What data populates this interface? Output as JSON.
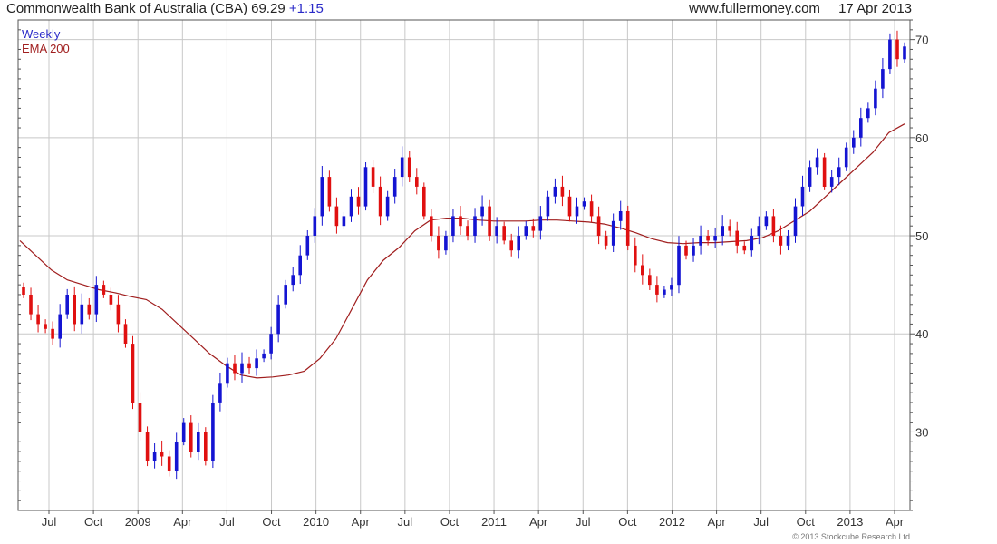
{
  "header": {
    "title": "Commonwealth Bank of Australia (CBA)",
    "price": "69.29",
    "change": "+1.15",
    "site": "www.fullermoney.com",
    "date": "17 Apr 2013"
  },
  "legend": {
    "line1": "Weekly",
    "line2": "EMA 200"
  },
  "copyright": "© 2013 Stockcube Research Ltd",
  "colors": {
    "up": "#1414d2",
    "down": "#e01010",
    "ema": "#a01e1e",
    "grid": "#c8c8c8",
    "axis": "#555555"
  },
  "chart_data": {
    "type": "candlestick",
    "x_ticks": [
      "Jul",
      "Oct",
      "2009",
      "Apr",
      "Jul",
      "Oct",
      "2010",
      "Apr",
      "Jul",
      "Oct",
      "2011",
      "Apr",
      "Jul",
      "Oct",
      "2012",
      "Apr",
      "Jul",
      "Oct",
      "2013",
      "Apr"
    ],
    "y_ticks": [
      30,
      40,
      50,
      60,
      70
    ],
    "ylim": [
      22,
      72
    ],
    "close": [
      44,
      42,
      41,
      40.5,
      39.5,
      42,
      44,
      41,
      43,
      42,
      45,
      44,
      43,
      41,
      39,
      33,
      30,
      27,
      28,
      27.5,
      26,
      29,
      31,
      28,
      30,
      27,
      33,
      35,
      37,
      36,
      37,
      36.5,
      37.5,
      38,
      40,
      43,
      45,
      46,
      48,
      50,
      52,
      56,
      53,
      51,
      52,
      54,
      53,
      57,
      55,
      52,
      54,
      56,
      58,
      56,
      55,
      52,
      50,
      48.5,
      50,
      52,
      51,
      50,
      52,
      53,
      50,
      51,
      49.5,
      48.5,
      50,
      51,
      50.5,
      52,
      54,
      55,
      54,
      52,
      53,
      53.5,
      52,
      50,
      49,
      51.5,
      52.5,
      49,
      47,
      46,
      45,
      44,
      44.5,
      45,
      49,
      48,
      49,
      50,
      49.5,
      50,
      51,
      50.5,
      49,
      48.5,
      50,
      51,
      52,
      50,
      49,
      50,
      53,
      55,
      57,
      58,
      55,
      56,
      57,
      59,
      60,
      62,
      63,
      65,
      67,
      70,
      68,
      69.29
    ],
    "ema200": [
      49.5,
      48,
      46.5,
      45.5,
      45,
      44.5,
      44.2,
      43.8,
      43.5,
      42.5,
      41,
      39.5,
      38,
      36.8,
      35.8,
      35.5,
      35.6,
      35.8,
      36.2,
      37.5,
      39.5,
      42.5,
      45.5,
      47.5,
      48.8,
      50.5,
      51.6,
      51.8,
      51.8,
      51.6,
      51.5,
      51.5,
      51.5,
      51.6,
      51.6,
      51.5,
      51.4,
      51.2,
      50.8,
      50.3,
      49.7,
      49.3,
      49.2,
      49.3,
      49.3,
      49.4,
      49.5,
      49.8,
      50.5,
      51.5,
      52.5,
      54,
      55.5,
      57,
      58.5,
      60.5,
      61.4
    ]
  }
}
